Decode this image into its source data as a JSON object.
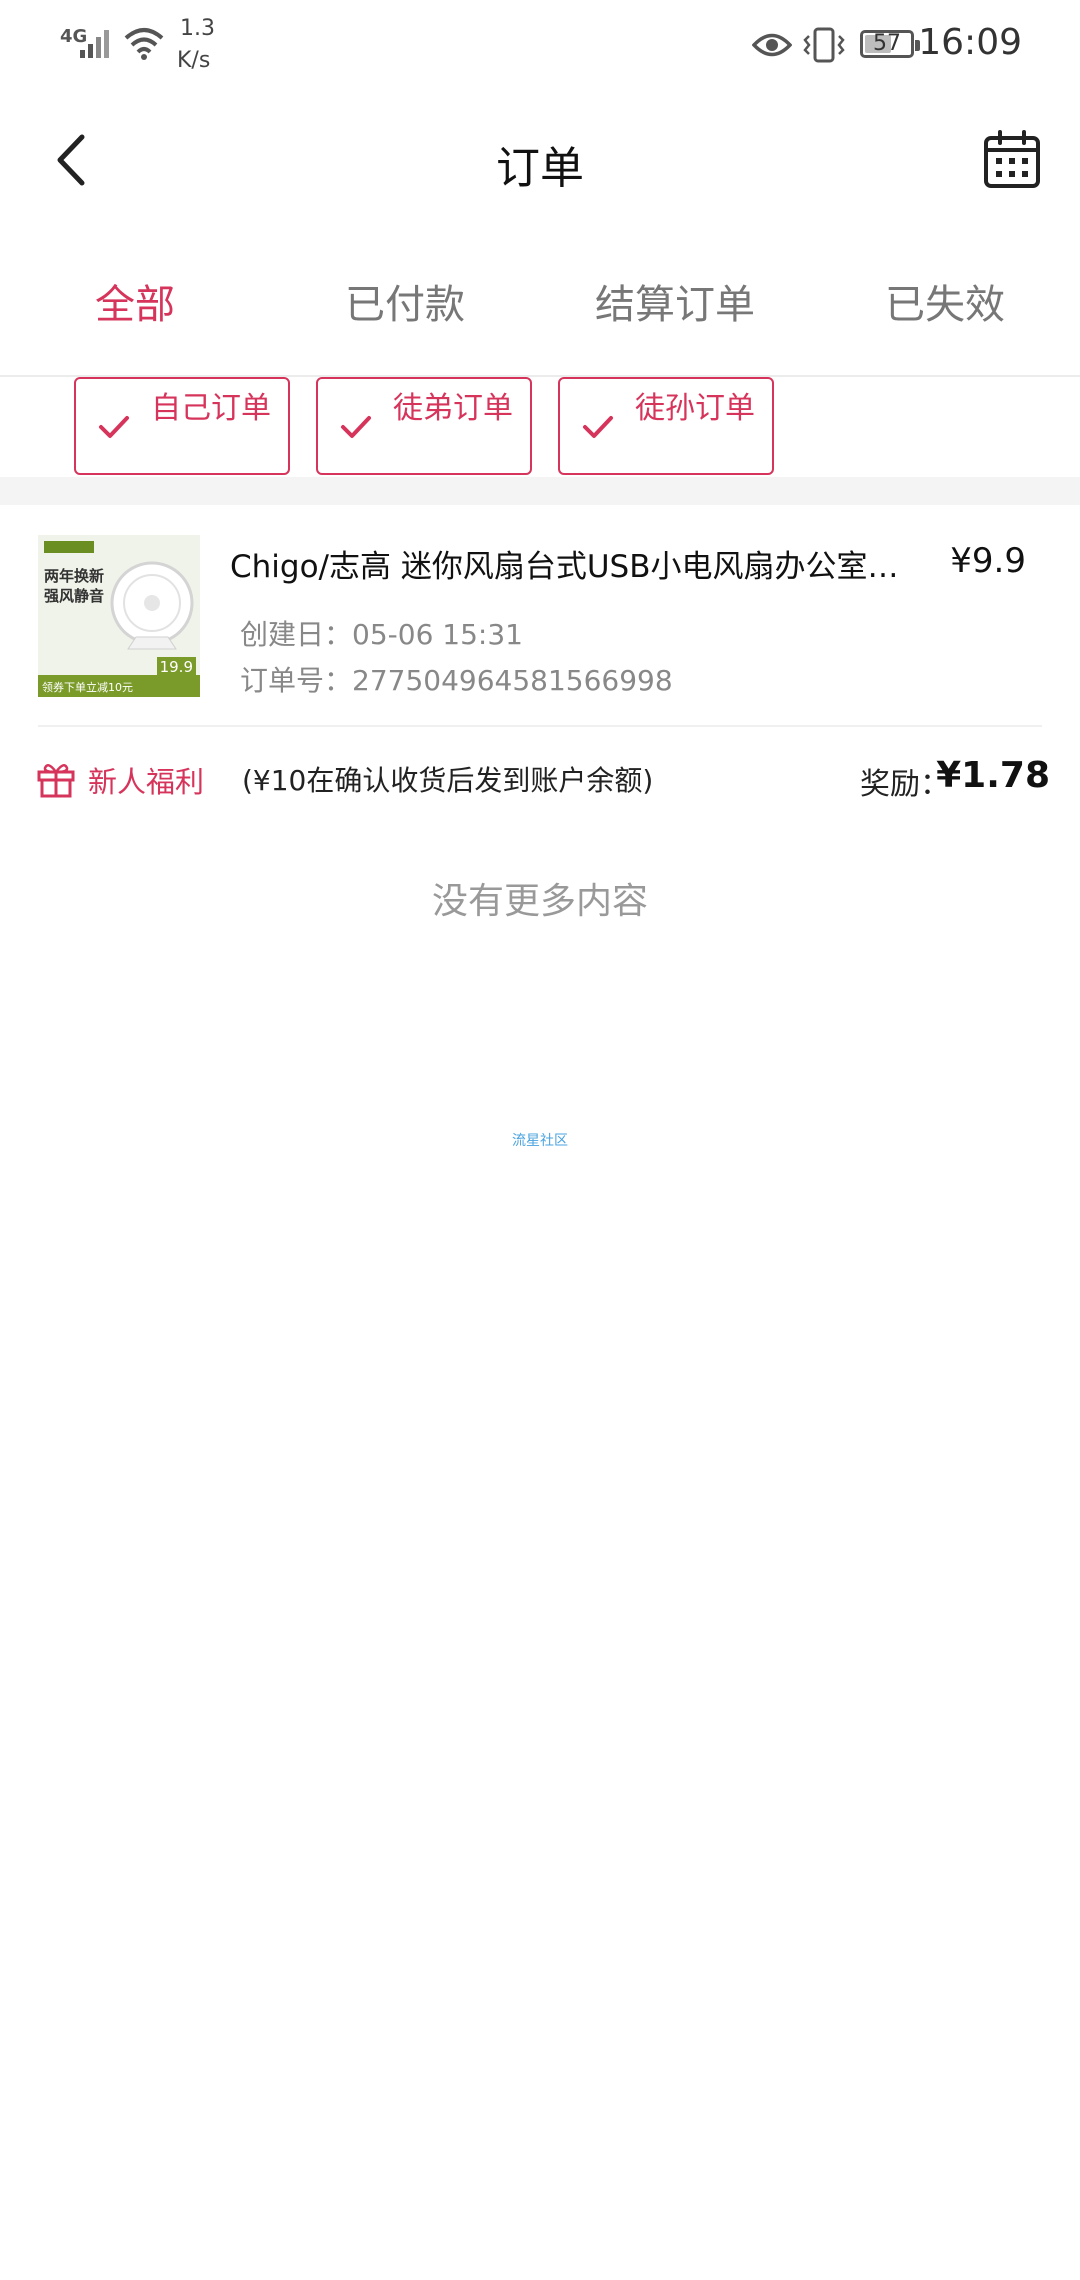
{
  "status_bar": {
    "network": "4G",
    "speed_value": "1.3",
    "speed_unit": "K/s",
    "battery": "57",
    "time": "16:09",
    "icons": [
      "signal-icon",
      "wifi-icon",
      "eye-icon",
      "vibrate-icon",
      "battery-icon"
    ]
  },
  "header": {
    "title": "订单",
    "back_icon": "chevron-left-icon",
    "calendar_icon": "calendar-icon"
  },
  "tabs": [
    {
      "label": "全部",
      "active": true
    },
    {
      "label": "已付款",
      "active": false
    },
    {
      "label": "结算订单",
      "active": false
    },
    {
      "label": "已失效",
      "active": false
    }
  ],
  "filters": [
    {
      "label": "自己订单",
      "checked": true
    },
    {
      "label": "徒弟订单",
      "checked": true
    },
    {
      "label": "徒孙订单",
      "checked": true
    }
  ],
  "order": {
    "thumbnail": {
      "line1": "两年换新",
      "line2": "强风静音",
      "bottom_text": "领券下单立减10元",
      "price_badge": "19.9"
    },
    "title": "Chigo/志高 迷你风扇台式USB小电风扇办公室小…",
    "price": "¥9.9",
    "created_label": "创建日：",
    "created_value": "05-06 15:31",
    "order_no_label": "订单号：",
    "order_no_value": "277504964581566998",
    "bonus_tag": "新人福利",
    "bonus_note": "(¥10在确认收货后发到账户余额)",
    "reward_label": "奖励：",
    "reward_value": "¥1.78"
  },
  "footer": {
    "no_more": "没有更多内容",
    "watermark": "流星社区"
  },
  "colors": {
    "accent": "#d6345b",
    "muted_text": "#888888",
    "separator": "#f4f4f4"
  }
}
